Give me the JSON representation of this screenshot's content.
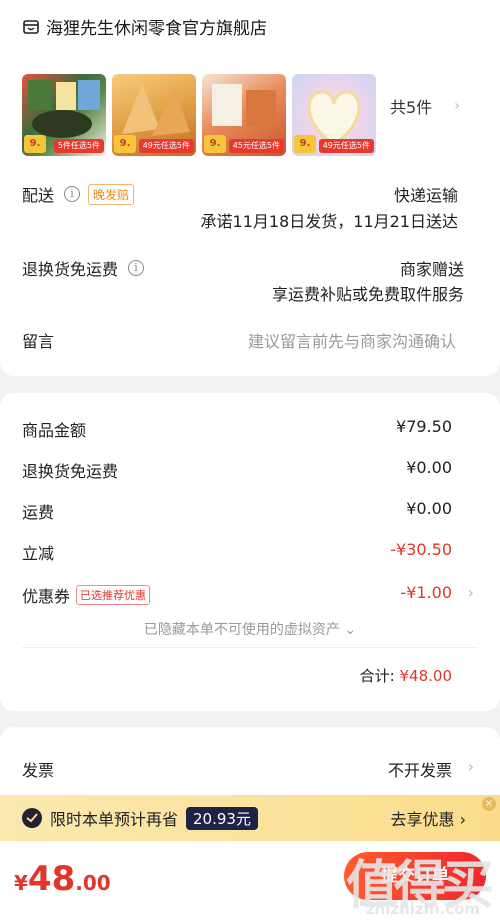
{
  "store": {
    "name": "海狸先生休闲零食官方旗舰店",
    "count_label": "共5件",
    "thumbnails": [
      {
        "tag": "9.",
        "ribbon": "5件任选5件"
      },
      {
        "tag": "9.",
        "ribbon": "49元任选5件"
      },
      {
        "tag": "9.",
        "ribbon": "45元任选5件"
      },
      {
        "tag": "9.",
        "ribbon": "49元任选5件"
      }
    ]
  },
  "delivery": {
    "label": "配送",
    "badge": "晚发赔",
    "method": "快递运输",
    "promise": "承诺11月18日发货，11月21日送达"
  },
  "return_insurance": {
    "label": "退换货免运费",
    "value": "商家赠送",
    "desc": "享运费补贴或免费取件服务"
  },
  "message": {
    "label": "留言",
    "placeholder": "建议留言前先与商家沟通确认"
  },
  "price": {
    "goods_label": "商品金额",
    "goods_value": "¥79.50",
    "return_label": "退换货免运费",
    "return_value": "¥0.00",
    "shipping_label": "运费",
    "shipping_value": "¥0.00",
    "discount_label": "立减",
    "discount_value": "-¥30.50",
    "coupon_label": "优惠券",
    "coupon_badge": "已选推荐优惠",
    "coupon_value": "-¥1.00",
    "hidden_assets": "已隐藏本单不可使用的虚拟资产",
    "total_label": "合计:",
    "total_value": "¥48.00"
  },
  "invoice": {
    "label": "发票",
    "value": "不开发票"
  },
  "promo": {
    "text": "限时本单预计再省",
    "amount": "20.93元",
    "action": "去享优惠"
  },
  "bottom": {
    "currency": "¥",
    "amount_int": "48",
    "amount_dec": ".00",
    "submit_label": "提交订单",
    "watermark": "值得买",
    "watermark_url": "zhizhizhi.com"
  },
  "colors": {
    "accent_red": "#e0362b",
    "promo_bg": "#fbdc8c"
  }
}
